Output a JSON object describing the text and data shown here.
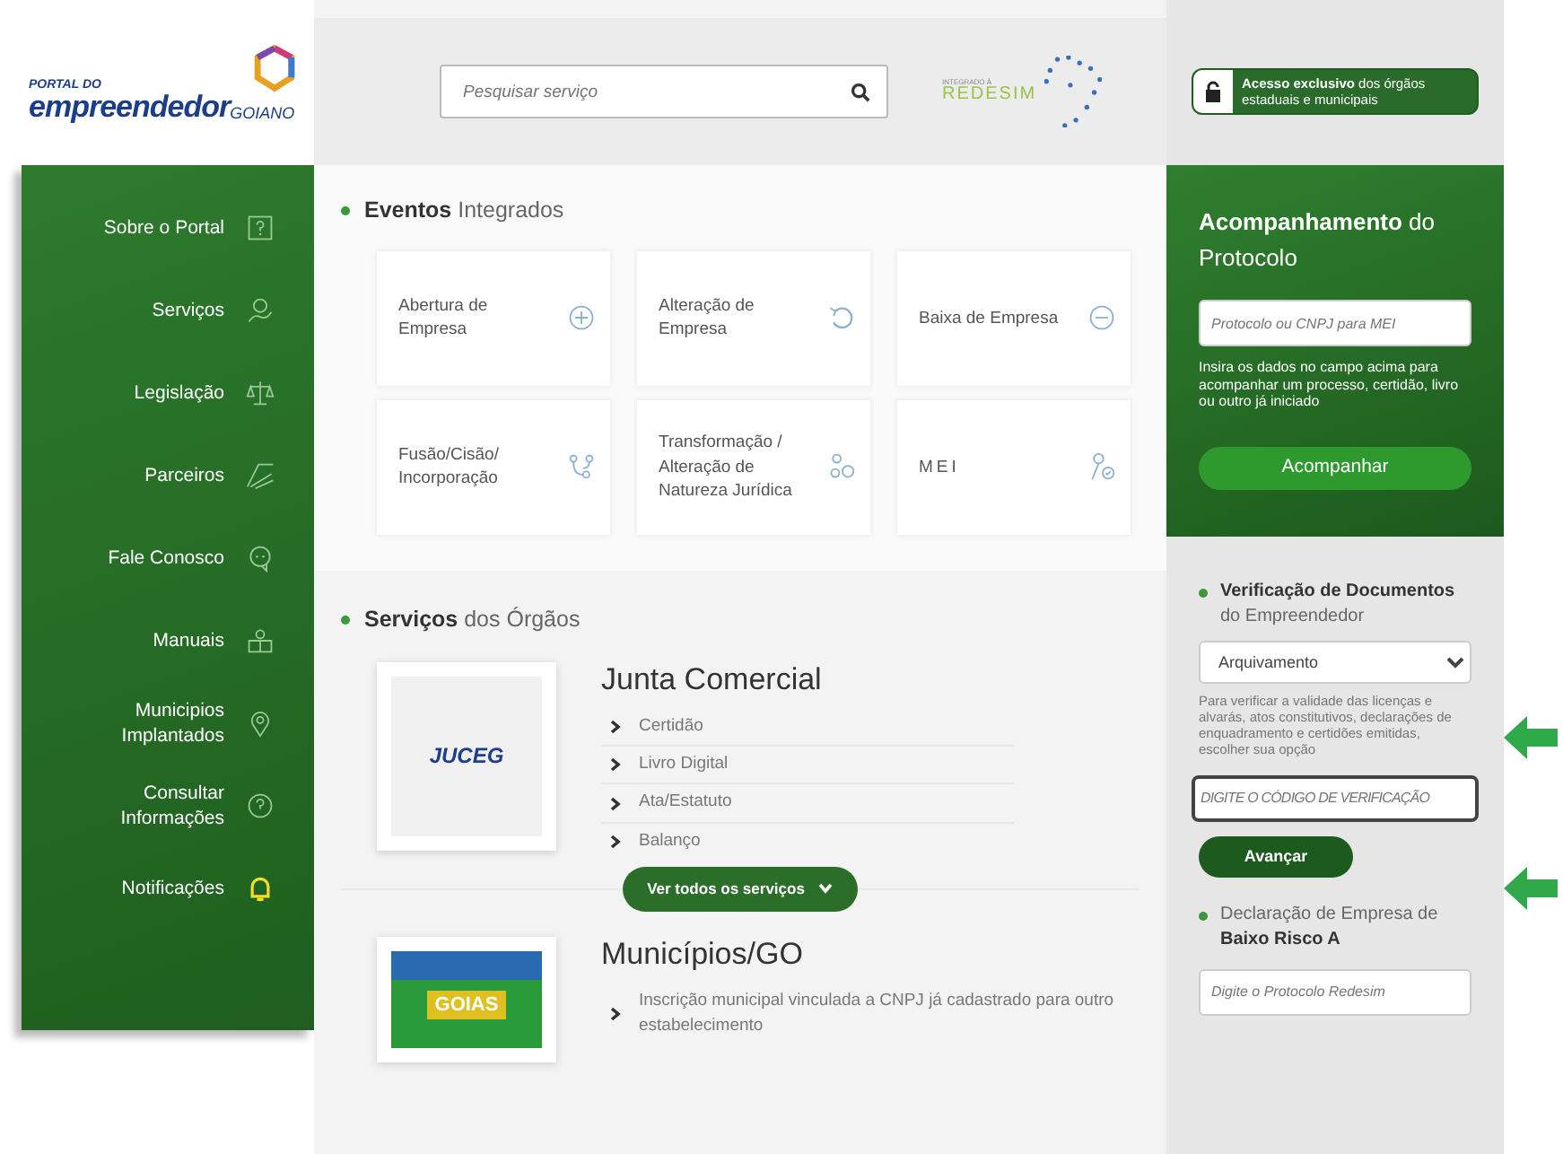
{
  "logo": {
    "top": "PORTAL DO",
    "main": "empreendedor",
    "suffix": "GOIANO"
  },
  "search": {
    "placeholder": "Pesquisar serviço"
  },
  "partner_logo": {
    "small": "INTEGRADO À",
    "name": "REDESIM"
  },
  "access_button": "**Acesso exclusivo** dos órgãos estaduais e municipais",
  "sidebar": {
    "items": [
      {
        "label": "Sobre o Portal",
        "highlighted": false
      },
      {
        "label": "Serviços",
        "highlighted": false
      },
      {
        "label": "Legislação",
        "highlighted": false
      },
      {
        "label": "Parceiros",
        "highlighted": false
      },
      {
        "label": "Fale Conosco",
        "highlighted": false
      },
      {
        "label": "Manuais",
        "highlighted": false
      },
      {
        "label": "Municipios Implantados",
        "highlighted": false
      },
      {
        "label": "Consultar Informações",
        "highlighted": false
      },
      {
        "label": "Notificações",
        "highlighted": true
      }
    ]
  },
  "events": {
    "title": "**Eventos** Integrados",
    "cards": [
      {
        "label": "Abertura de Empresa"
      },
      {
        "label": "Alteração de Empresa"
      },
      {
        "label": "Baixa de Empresa"
      },
      {
        "label": "Fusão/Cisão/ Incorporação"
      },
      {
        "label": "Transformação / Alteração de Natureza Jurídica"
      },
      {
        "label": "MEI"
      }
    ]
  },
  "services": {
    "title": "**Serviços** dos Órgãos",
    "agencies": [
      {
        "name": "Junta Comercial",
        "logo": "JUCEG",
        "links": [
          "Certidão",
          "Livro Digital",
          "Ata/Estatuto",
          "Balanço"
        ],
        "button": "Ver todos os serviços"
      },
      {
        "name": "Municípios/GO",
        "logo": "GOIAS",
        "links": [
          "Inscrição municipal vinculada a CNPJ já cadastrado para outro estabelecimento"
        ]
      }
    ]
  },
  "protocol": {
    "title": "**Acompanhamento** do Protocolo",
    "placeholder": "Protocolo ou CNPJ para MEI",
    "help": "Insira os dados no campo acima para acompanhar um processo, certidão, livro ou outro já iniciado",
    "button": "Acompanhar"
  },
  "verification": {
    "title": "**Verificação de Documentos** do Empreendedor",
    "select_value": "Arquivamento",
    "help": "Para verificar a validade das licenças e alvarás, atos constitutivos, declarações de enquadramento e certidões emitidas, escolher sua opção",
    "placeholder": "DIGITE O CÓDIGO DE VERIFICAÇÃO",
    "button": "Avançar"
  },
  "low_risk": {
    "title": "Declaração de Empresa de **Baixo Risco A**",
    "placeholder": "Digite o Protocolo Redesim"
  }
}
